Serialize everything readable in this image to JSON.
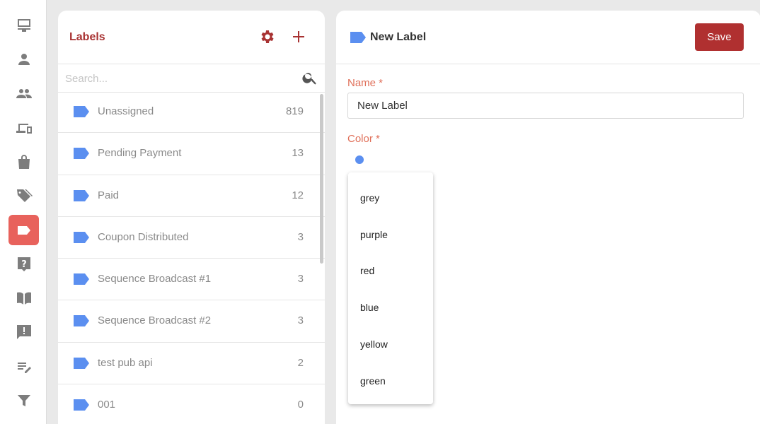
{
  "nav": {
    "items": [
      {
        "icon": "inbox-icon",
        "name": "nav-inbox"
      },
      {
        "icon": "person-icon",
        "name": "nav-contacts"
      },
      {
        "icon": "group-icon",
        "name": "nav-teams"
      },
      {
        "icon": "devices-icon",
        "name": "nav-devices"
      },
      {
        "icon": "shopping-bag-icon",
        "name": "nav-orders"
      },
      {
        "icon": "price-tags-icon",
        "name": "nav-tags"
      },
      {
        "icon": "label-icon",
        "name": "nav-labels",
        "active": true
      },
      {
        "icon": "help-icon",
        "name": "nav-help"
      },
      {
        "icon": "book-icon",
        "name": "nav-knowledge-base"
      },
      {
        "icon": "feedback-icon",
        "name": "nav-feedback"
      },
      {
        "icon": "edit-list-icon",
        "name": "nav-notes"
      },
      {
        "icon": "filter-icon",
        "name": "nav-filters"
      }
    ]
  },
  "labels_panel": {
    "title": "Labels",
    "search_placeholder": "Search...",
    "items": [
      {
        "name": "Unassigned",
        "count": "819"
      },
      {
        "name": "Pending Payment",
        "count": "13"
      },
      {
        "name": "Paid",
        "count": "12"
      },
      {
        "name": "Coupon Distributed",
        "count": "3"
      },
      {
        "name": "Sequence Broadcast #1",
        "count": "3"
      },
      {
        "name": "Sequence Broadcast #2",
        "count": "3"
      },
      {
        "name": "test pub api",
        "count": "2"
      },
      {
        "name": "001",
        "count": "0"
      }
    ]
  },
  "detail": {
    "title": "New Label",
    "save_label": "Save",
    "name_label": "Name *",
    "name_value": "New Label",
    "color_label": "Color *",
    "selected_color": "#5b8ff0",
    "color_options": [
      "grey",
      "purple",
      "red",
      "blue",
      "yellow",
      "green"
    ]
  },
  "colors": {
    "accent": "#a83232",
    "active_nav": "#e8625c",
    "tag_blue": "#5b8ff0",
    "field_label": "#e0705a"
  }
}
